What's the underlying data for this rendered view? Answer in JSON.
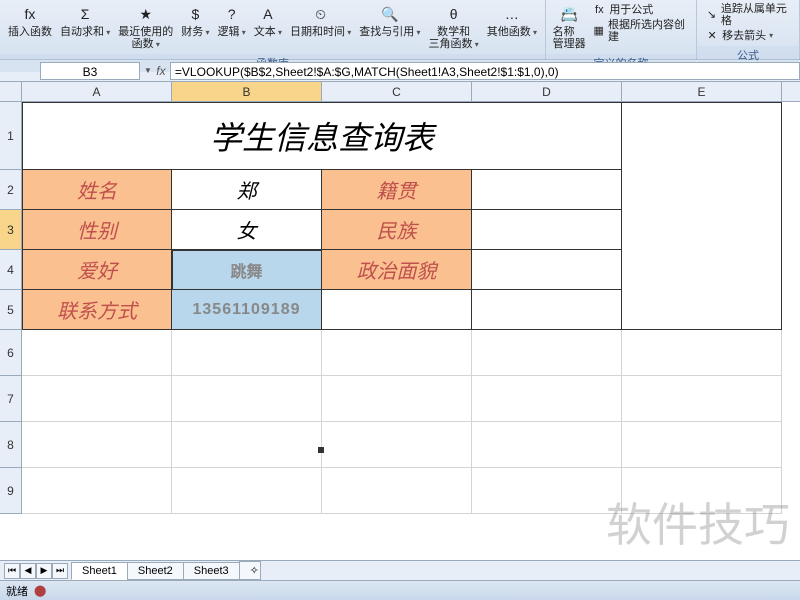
{
  "ribbon": {
    "groups": [
      {
        "label": "函数库",
        "items": [
          {
            "name": "insert-function",
            "label": "插入函数",
            "icon": "fx"
          },
          {
            "name": "autosum",
            "label": "自动求和",
            "icon": "Σ",
            "drop": true
          },
          {
            "name": "recent",
            "label": "最近使用的\n函数",
            "icon": "★",
            "drop": true
          },
          {
            "name": "financial",
            "label": "财务",
            "icon": "$",
            "drop": true
          },
          {
            "name": "logical",
            "label": "逻辑",
            "icon": "?",
            "drop": true
          },
          {
            "name": "text",
            "label": "文本",
            "icon": "A",
            "drop": true
          },
          {
            "name": "datetime",
            "label": "日期和时间",
            "icon": "⏲",
            "drop": true
          },
          {
            "name": "lookup",
            "label": "查找与引用",
            "icon": "🔍",
            "drop": true
          },
          {
            "name": "math",
            "label": "数学和\n三角函数",
            "icon": "θ",
            "drop": true
          },
          {
            "name": "more",
            "label": "其他函数",
            "icon": "…",
            "drop": true
          }
        ]
      },
      {
        "label": "定义的名称",
        "items": [
          {
            "name": "name-manager",
            "label": "名称\n管理器",
            "icon": "📇"
          }
        ],
        "small": [
          {
            "name": "show-formulas",
            "label": "用于公式",
            "icon": "fx"
          },
          {
            "name": "create-from-selection",
            "label": "根据所选内容创建",
            "icon": "▦"
          }
        ]
      },
      {
        "label": "公式",
        "small": [
          {
            "name": "trace-dependents",
            "label": "追踪从属单元格",
            "icon": "↘"
          },
          {
            "name": "remove-arrows",
            "label": "移去箭头",
            "icon": "✕",
            "drop": true
          }
        ]
      }
    ]
  },
  "namebox": {
    "cell": "B3",
    "formula": "=VLOOKUP($B$2,Sheet2!$A:$G,MATCH(Sheet1!A3,Sheet2!$1:$1,0),0)"
  },
  "columns": [
    {
      "l": "A",
      "w": 150
    },
    {
      "l": "B",
      "w": 150
    },
    {
      "l": "C",
      "w": 150
    },
    {
      "l": "D",
      "w": 150
    },
    {
      "l": "E",
      "w": 160
    }
  ],
  "rows": [
    {
      "n": "1",
      "h": 68
    },
    {
      "n": "2",
      "h": 40
    },
    {
      "n": "3",
      "h": 40
    },
    {
      "n": "4",
      "h": 40
    },
    {
      "n": "5",
      "h": 40
    },
    {
      "n": "6",
      "h": 46
    },
    {
      "n": "7",
      "h": 46
    },
    {
      "n": "8",
      "h": 46
    },
    {
      "n": "9",
      "h": 46
    }
  ],
  "data": {
    "title": "学生信息查询表",
    "labels": {
      "name": "姓名",
      "origin": "籍贯",
      "gender": "性别",
      "ethnic": "民族",
      "hobby": "爱好",
      "politics": "政治面貌",
      "contact": "联系方式"
    },
    "values": {
      "name": "郑",
      "gender": "女",
      "hobby": "跳舞",
      "contact": "13561109189"
    }
  },
  "sheets": {
    "active": "Sheet1",
    "list": [
      "Sheet1",
      "Sheet2",
      "Sheet3"
    ]
  },
  "status": "就绪",
  "watermark": "软件技巧"
}
